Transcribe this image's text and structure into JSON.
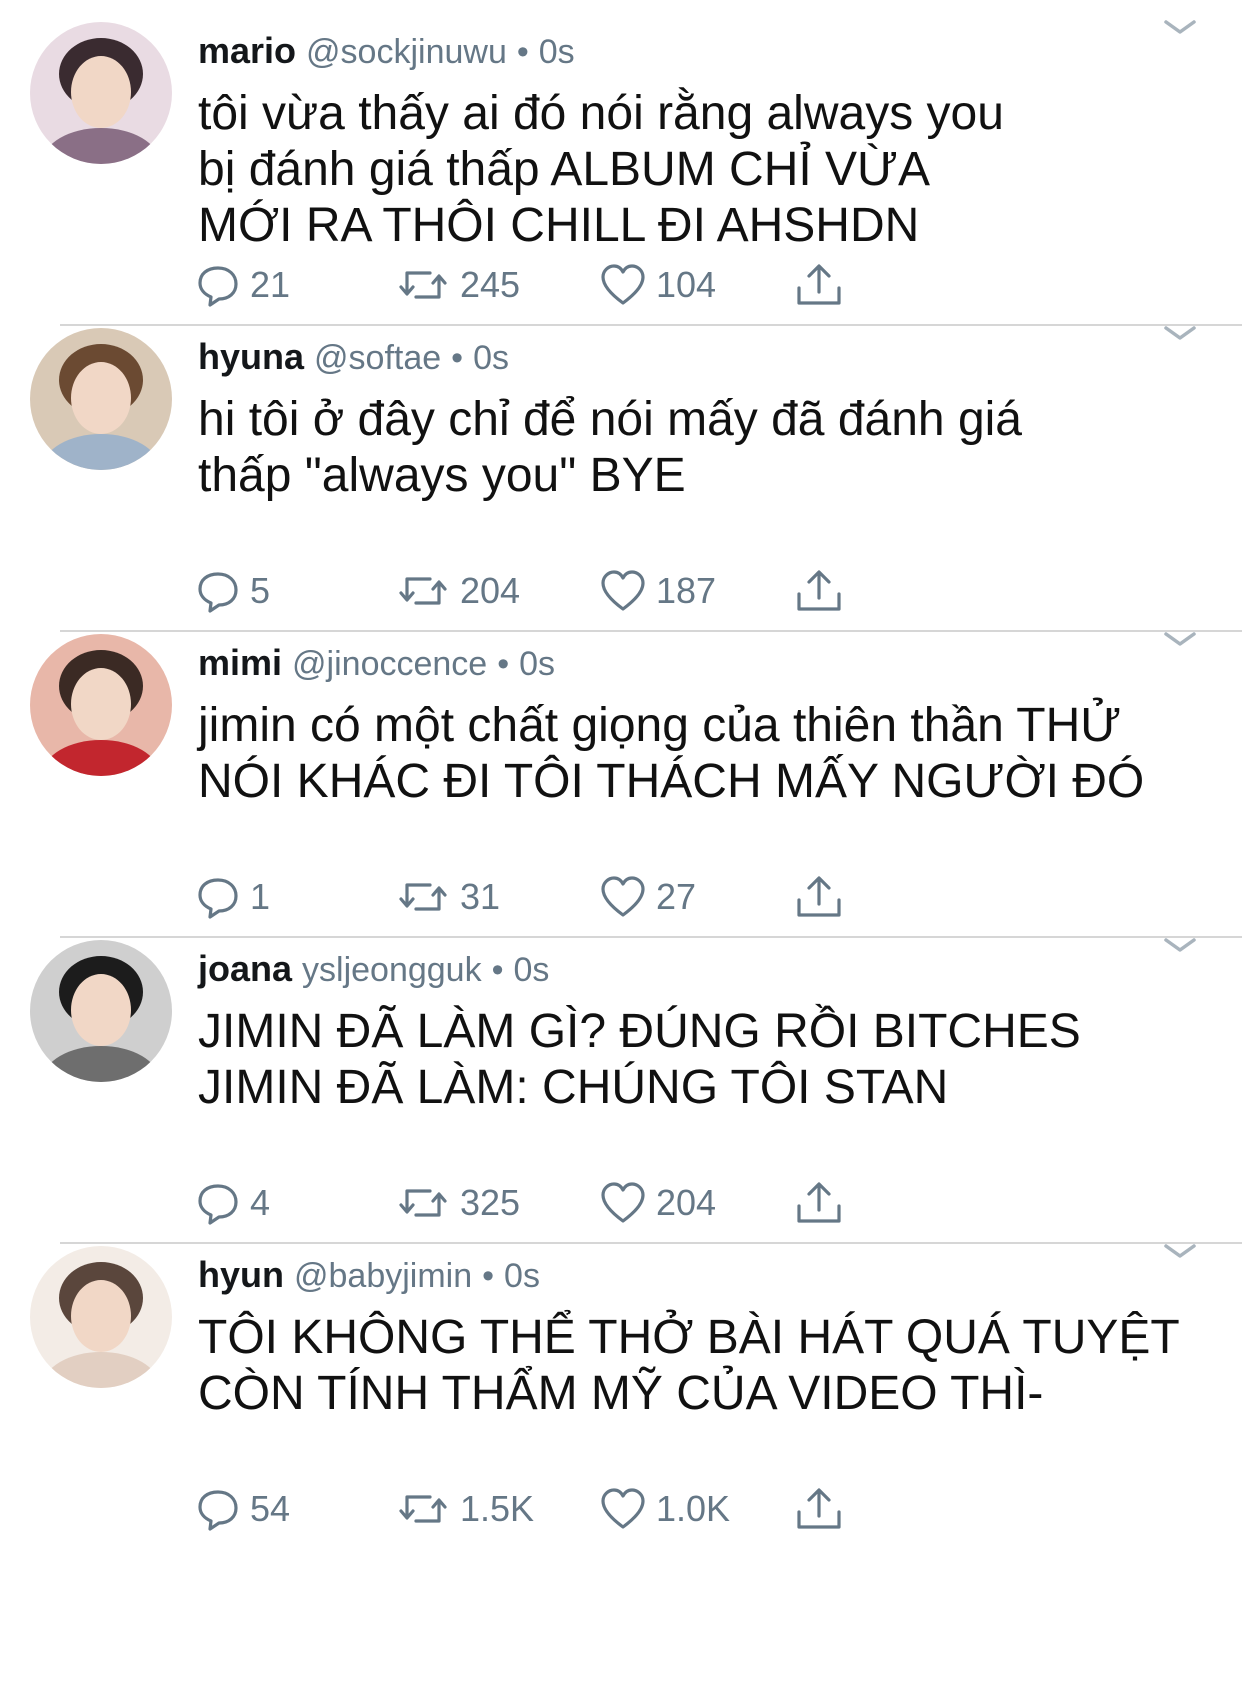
{
  "tweets": [
    {
      "name": "mario",
      "handle": "@sockjinuwu",
      "time": "0s",
      "text": "tôi vừa thấy ai đó nói rằng always you\nbị đánh giá thấp ALBUM CHỈ VỪA\nMỚI RA THÔI CHILL ĐI AHSHDN",
      "replies": "21",
      "retweets": "245",
      "likes": "104",
      "avatar_colors": [
        "#e9dbe3",
        "#3a2b30",
        "#8a6f86"
      ]
    },
    {
      "name": "hyuna",
      "handle": "@softae",
      "time": "0s",
      "text": "hi tôi ở đây chỉ để nói mấy đã đánh giá\nthấp \"always you\" BYE",
      "replies": "5",
      "retweets": "204",
      "likes": "187",
      "avatar_colors": [
        "#d9c9b6",
        "#6b4a32",
        "#9fb3c9"
      ]
    },
    {
      "name": "mimi",
      "handle": "@jinoccence",
      "time": "0s",
      "text": "jimin có một chất giọng của thiên thần THỬ\nNÓI KHÁC ĐI TÔI THÁCH MẤY NGƯỜI ĐÓ",
      "replies": "1",
      "retweets": "31",
      "likes": "27",
      "avatar_colors": [
        "#e8b7a9",
        "#3b2a24",
        "#c2262e"
      ]
    },
    {
      "name": "joana",
      "handle": "ysljeongguk",
      "time": "0s",
      "text": "JIMIN ĐÃ LÀM GÌ? ĐÚNG RỒI BITCHES\nJIMIN ĐÃ LÀM: CHÚNG TÔI STAN",
      "replies": "4",
      "retweets": "325",
      "likes": "204",
      "avatar_colors": [
        "#cfcfcf",
        "#1c1c1c",
        "#6e6e6e"
      ]
    },
    {
      "name": "hyun",
      "handle": "@babyjimin",
      "time": "0s",
      "text": "TÔI KHÔNG THỂ THỞ BÀI HÁT QUÁ TUYỆT\nCÒN TÍNH THẨM MỸ CỦA VIDEO THÌ-",
      "replies": "54",
      "retweets": "1.5K",
      "likes": "1.0K",
      "avatar_colors": [
        "#f3ece6",
        "#5a463c",
        "#e2cfc2"
      ]
    }
  ],
  "icons": {
    "reply": "reply-icon",
    "retweet": "retweet-icon",
    "like": "heart-icon",
    "share": "share-icon",
    "more": "chevron-down-icon"
  },
  "colors": {
    "meta": "#657786",
    "divider": "#d6d6d6"
  }
}
